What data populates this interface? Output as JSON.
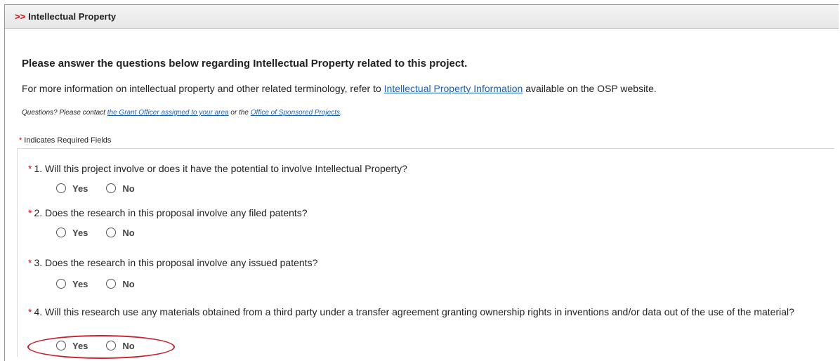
{
  "section": {
    "arrows": ">>",
    "title": "Intellectual Property"
  },
  "intro": {
    "title": "Please answer the questions below regarding Intellectual Property related to this project.",
    "info_prefix": "For more information on intellectual property and other related terminology, refer to ",
    "info_link": "Intellectual Property Information",
    "info_suffix": " available on the OSP website.",
    "contact_prefix": "Questions? Please contact ",
    "contact_link1": "the Grant Officer assigned to your area",
    "contact_middle": " or the ",
    "contact_link2": "Office of Sponsored Projects",
    "contact_suffix": "."
  },
  "required_note": {
    "star": "*",
    "text": "Indicates Required Fields"
  },
  "questions": [
    {
      "star": "*",
      "text": "1.  Will this project involve or does it have the potential to involve Intellectual Property?",
      "yes": "Yes",
      "no": "No"
    },
    {
      "star": "*",
      "text": "2.  Does the research in this proposal involve any filed patents?",
      "yes": "Yes",
      "no": "No"
    },
    {
      "star": "*",
      "text": "3.  Does the research in this proposal involve any issued patents?",
      "yes": "Yes",
      "no": "No"
    },
    {
      "star": "*",
      "text": "4.  Will this research use any materials obtained from a third party under a transfer agreement granting ownership rights in inventions and/or data out of the use of the material?",
      "yes": "Yes",
      "no": "No"
    }
  ],
  "colors": {
    "header_arrows": "#cc0000",
    "required_star": "#dd0000",
    "link": "#1a5fb4",
    "annotation": "#c8202f"
  }
}
